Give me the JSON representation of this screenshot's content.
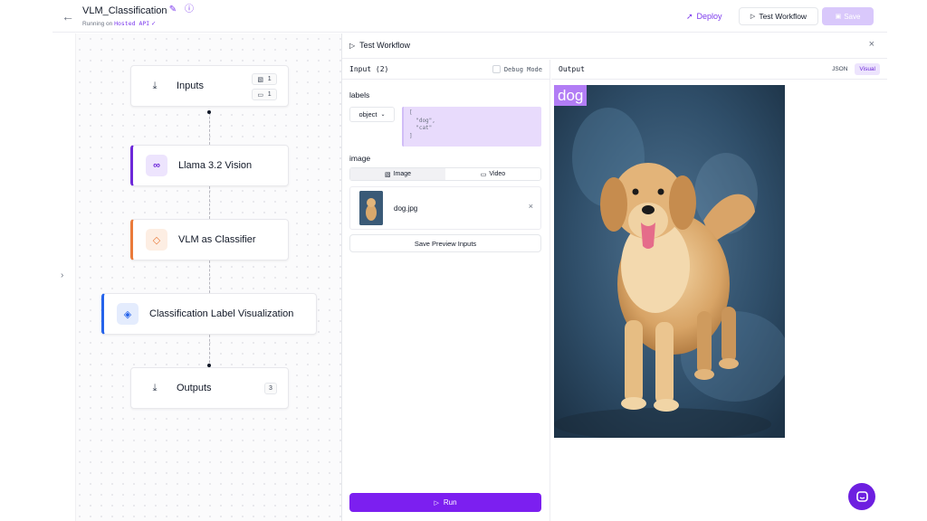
{
  "header": {
    "title": "VLM_Classification",
    "running_prefix": "Running on",
    "running_target": "Hosted API",
    "deploy_label": "Deploy",
    "test_workflow_label": "Test Workflow",
    "save_label": "Save"
  },
  "nodes": {
    "inputs": {
      "label": "Inputs",
      "image_count": "1",
      "param_count": "1"
    },
    "llama": {
      "label": "Llama 3.2 Vision"
    },
    "classifier": {
      "label": "VLM as Classifier"
    },
    "visualization": {
      "label": "Classification Label Visualization"
    },
    "outputs": {
      "label": "Outputs",
      "count": "3"
    }
  },
  "panel": {
    "title": "Test Workflow",
    "input_header": "Input (2)",
    "debug_label": "Debug Mode",
    "labels_title": "labels",
    "labels_type": "object",
    "labels_json": "[\n  \"dog\",\n  \"cat\"\n]",
    "image_title": "image",
    "tab_image": "Image",
    "tab_video": "Video",
    "file_name": "dog.jpg",
    "save_preview_label": "Save Preview Inputs",
    "run_label": "Run",
    "output_header": "Output",
    "toggle_json": "JSON",
    "toggle_visual": "Visual",
    "output_label": "dog"
  },
  "colors": {
    "accent": "#7c3aed",
    "run_button": "#7c1ff0",
    "node_llama": "#6d28d9",
    "node_classifier": "#ea7a3a",
    "node_visualization": "#2563eb",
    "label_overlay": "#b27df5"
  }
}
